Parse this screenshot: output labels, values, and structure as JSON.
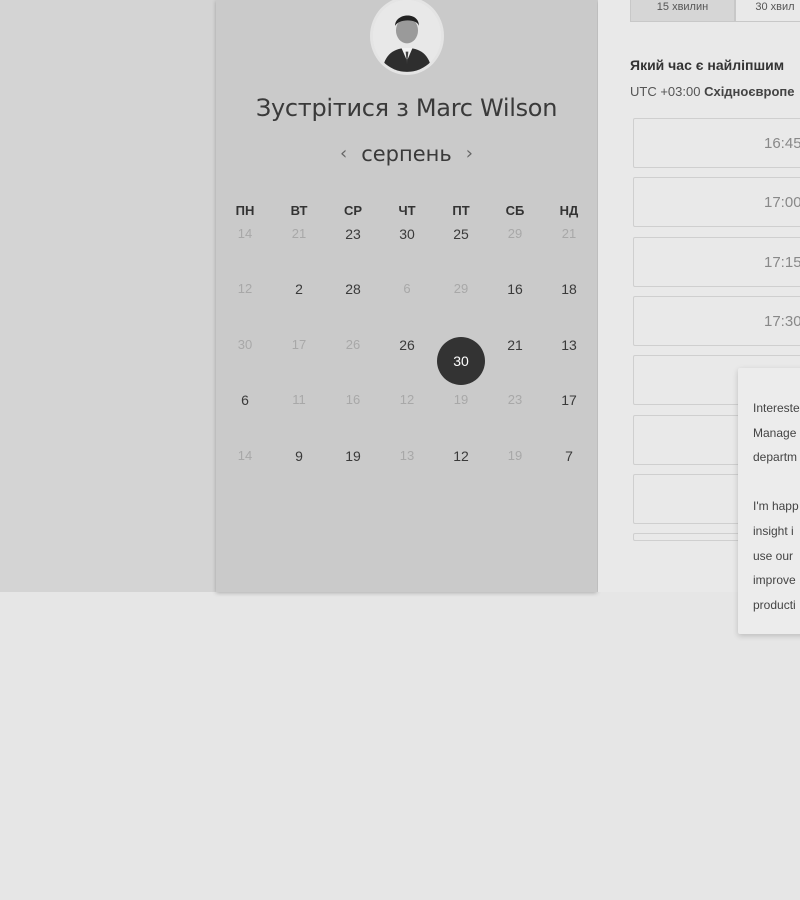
{
  "header": {
    "title": "Зустрітися з Marc Wilson"
  },
  "calendar": {
    "month": "серпень",
    "prev_arrow": "‹",
    "next_arrow": "›",
    "weekdays": [
      "ПН",
      "ВТ",
      "СР",
      "ЧТ",
      "ПТ",
      "СБ",
      "НД"
    ],
    "weeks": [
      [
        "14",
        "21",
        "23",
        "30",
        "25",
        "29",
        "21"
      ],
      [
        "12",
        "2",
        "28",
        "6",
        "29",
        "16",
        "18"
      ],
      [
        "30",
        "17",
        "26",
        "26",
        "30",
        "21",
        "13"
      ],
      [
        "6",
        "11",
        "16",
        "12",
        "19",
        "23",
        "17"
      ],
      [
        "14",
        "9",
        "19",
        "13",
        "12",
        "19",
        "7"
      ]
    ],
    "muted": [
      [
        true,
        true,
        false,
        false,
        false,
        true,
        true
      ],
      [
        true,
        false,
        false,
        true,
        true,
        false,
        false
      ],
      [
        true,
        true,
        true,
        false,
        false,
        false,
        false
      ],
      [
        false,
        true,
        true,
        true,
        true,
        true,
        false
      ],
      [
        true,
        false,
        false,
        true,
        false,
        true,
        false
      ]
    ],
    "selected": {
      "week": 2,
      "day": 4
    }
  },
  "durations": [
    "15 хвилин",
    "30 хвил"
  ],
  "booking": {
    "question": "Який час є найліпшим",
    "timezone_prefix": "UTC +03:00",
    "timezone_name": "Східноєвропе",
    "slots": [
      "16:45",
      "17:00",
      "17:15",
      "17:30",
      "",
      "",
      "",
      ""
    ]
  },
  "popup": {
    "lines": [
      "Interested",
      "Manage",
      "departm",
      "",
      "I'm happ",
      "insight i",
      "use our",
      "improve",
      "producti"
    ]
  },
  "colors": {
    "selected_day": "#333333",
    "panel": "#cacaca",
    "background": "#e6e6e6"
  }
}
